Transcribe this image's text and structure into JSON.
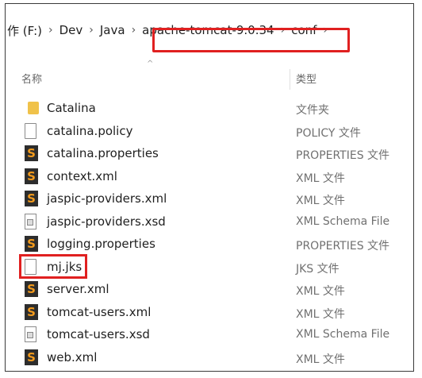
{
  "breadcrumb": {
    "items": [
      "作 (F:)",
      "Dev",
      "Java",
      "apache-tomcat-9.0.34",
      "conf"
    ],
    "separator": "›"
  },
  "columns": {
    "name": "名称",
    "type": "类型"
  },
  "files": [
    {
      "name": "Catalina",
      "type": "文件夹",
      "icon": "folder-icon"
    },
    {
      "name": "catalina.policy",
      "type": "POLICY 文件",
      "icon": "document-icon"
    },
    {
      "name": "catalina.properties",
      "type": "PROPERTIES 文件",
      "icon": "sublime-file-icon"
    },
    {
      "name": "context.xml",
      "type": "XML 文件",
      "icon": "sublime-file-icon"
    },
    {
      "name": "jaspic-providers.xml",
      "type": "XML 文件",
      "icon": "sublime-file-icon"
    },
    {
      "name": "jaspic-providers.xsd",
      "type": "XML Schema File",
      "icon": "xsd-file-icon"
    },
    {
      "name": "logging.properties",
      "type": "PROPERTIES 文件",
      "icon": "sublime-file-icon"
    },
    {
      "name": "mj.jks",
      "type": "JKS 文件",
      "icon": "document-icon"
    },
    {
      "name": "server.xml",
      "type": "XML 文件",
      "icon": "sublime-file-icon"
    },
    {
      "name": "tomcat-users.xml",
      "type": "XML 文件",
      "icon": "sublime-file-icon"
    },
    {
      "name": "tomcat-users.xsd",
      "type": "XML Schema File",
      "icon": "xsd-file-icon"
    },
    {
      "name": "web.xml",
      "type": "XML 文件",
      "icon": "sublime-file-icon"
    }
  ],
  "colors": {
    "highlight": "#e02020",
    "folder": "#f0c24a",
    "sublime_bg": "#2d2d2d",
    "sublime_fg": "#f29a1c"
  }
}
